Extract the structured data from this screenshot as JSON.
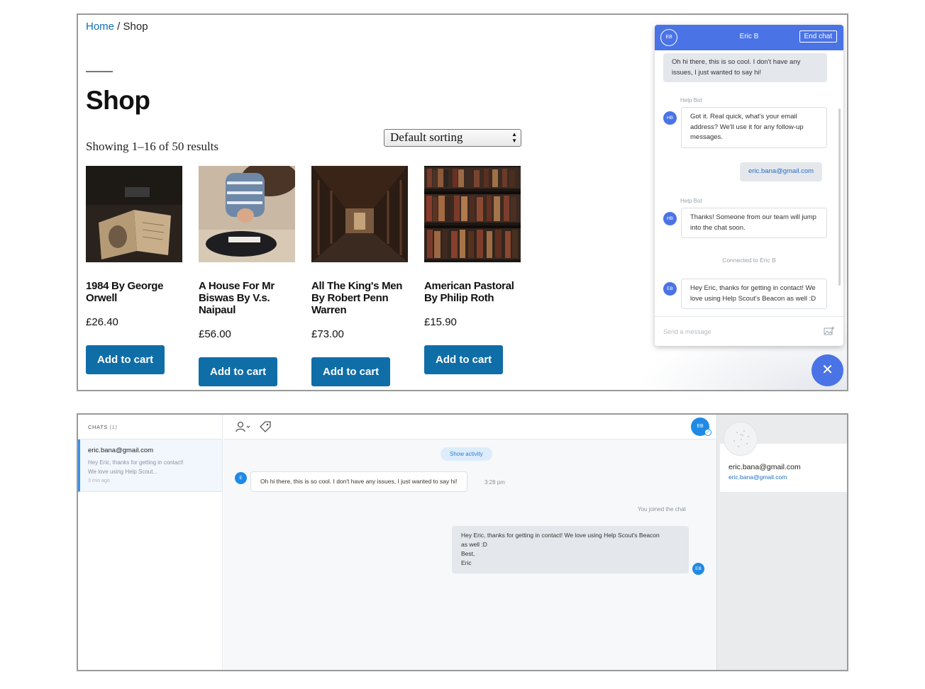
{
  "shop": {
    "breadcrumb": {
      "home": "Home",
      "separator": " / ",
      "current": "Shop"
    },
    "title": "Shop",
    "result_count": "Showing 1–16 of 50 results",
    "sorting": {
      "selected": "Default sorting"
    },
    "products": [
      {
        "name": "1984 By George Orwell",
        "price": "£26.40",
        "button": "Add to cart",
        "image": "open-old-book-photo"
      },
      {
        "name": "A House For Mr Biswas By V.s. Naipaul",
        "price": "£56.00",
        "button": "Add to cart",
        "image": "person-reading-book-photo"
      },
      {
        "name": "All The King's Men By Robert Penn Warren",
        "price": "£73.00",
        "button": "Add to cart",
        "image": "library-hall-photo"
      },
      {
        "name": "American Pastoral By Philip Roth",
        "price": "£15.90",
        "button": "Add to cart",
        "image": "bookshelf-photo"
      }
    ]
  },
  "beacon": {
    "header": {
      "avatar_initials": "EB",
      "agent_name": "Eric B",
      "end_chat": "End chat"
    },
    "messages": [
      {
        "from": "customer",
        "text": "Oh hi there, this is so cool. I don't have any issues, I just wanted to say hi!"
      },
      {
        "from": "bot",
        "label": "Help Bot",
        "initials": "HB",
        "text": "Got it. Real quick, what's your email address? We'll use it for any follow-up messages."
      },
      {
        "from": "customer",
        "text": "eric.bana@gmail.com"
      },
      {
        "from": "bot",
        "label": "Help Bot",
        "initials": "HB",
        "text": "Thanks! Someone from our team will jump into the chat soon."
      },
      {
        "from": "system",
        "text": "Connected to Eric B"
      },
      {
        "from": "agent",
        "initials": "EB",
        "text": "Hey Eric, thanks for getting in contact! We love using Help Scout's Beacon as well :D"
      }
    ],
    "composer_placeholder": "Send a message",
    "close_symbol": "✕"
  },
  "inbox": {
    "chats_header": {
      "label": "CHATS",
      "count": "(1)"
    },
    "chat_item": {
      "email": "eric.bana@gmail.com",
      "preview_line1": "Hey Eric, thanks for getting in contact!",
      "preview_line2": "We love using Help Scout...",
      "time": "3 min ago"
    },
    "conversation": {
      "agent_initials": "EB",
      "show_activity": "Show activity",
      "customer_initial": "E",
      "customer_message": "Oh hi there, this is so cool. I don't have any issues, I just wanted to say hi!",
      "customer_time": "3:28 pm",
      "joined_notice": "You joined the chat",
      "agent_message_lines": [
        "Hey Eric, thanks for getting in contact! We love using Help Scout's Beacon",
        "as well :D",
        "Best,",
        "Eric"
      ]
    },
    "profile": {
      "name": "eric.bana@gmail.com",
      "email": "eric.bana@gmail.com"
    }
  },
  "colors": {
    "shop_button": "#0f6ea8",
    "beacon_blue": "#4a73e6",
    "link_blue": "#0f6eb4",
    "inbox_accent": "#1f8ae6"
  }
}
